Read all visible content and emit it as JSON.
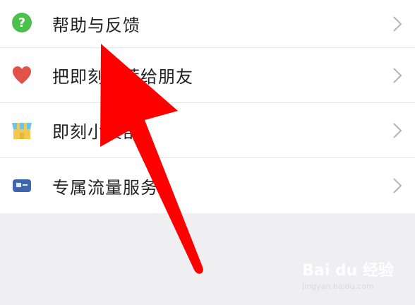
{
  "menu": {
    "items": [
      {
        "label": "帮助与反馈",
        "icon": "help-icon"
      },
      {
        "label": "把即刻推荐给朋友",
        "icon": "heart-icon"
      },
      {
        "label": "即刻小卖部",
        "icon": "shop-icon"
      },
      {
        "label": "专属流量服务",
        "icon": "card-icon"
      }
    ]
  },
  "watermark": {
    "logo": "Bai du 经验",
    "url": "jingyan.baidu.com"
  },
  "colors": {
    "help_green": "#4cc04c",
    "heart_red": "#e0524a",
    "arrow_red": "#ff0000",
    "card_blue": "#3d66ad"
  }
}
